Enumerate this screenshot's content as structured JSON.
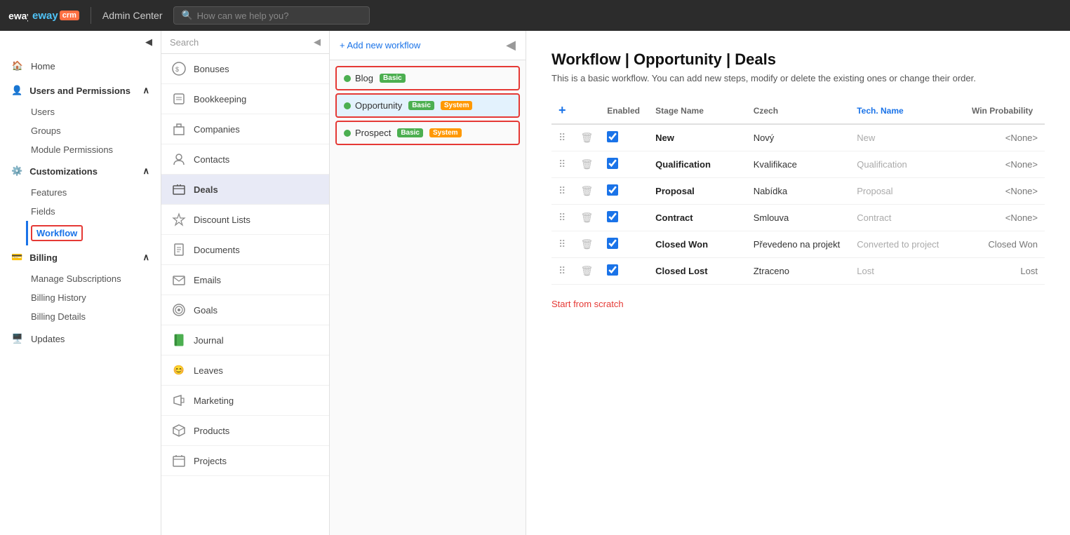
{
  "topbar": {
    "logo_text": "eway",
    "logo_suffix": "crm",
    "title": "Admin Center",
    "search_placeholder": "How can we help you?"
  },
  "sidebar": {
    "collapse_icon": "◀",
    "home_label": "Home",
    "users_section_label": "Users and Permissions",
    "users_items": [
      "Users",
      "Groups",
      "Module Permissions"
    ],
    "customizations_label": "Customizations",
    "customizations_items": [
      "Features",
      "Fields"
    ],
    "workflow_label": "Workflow",
    "billing_label": "Billing",
    "billing_items": [
      "Manage Subscriptions",
      "Billing History",
      "Billing Details"
    ],
    "updates_label": "Updates"
  },
  "module_panel": {
    "search_placeholder": "Search",
    "collapse_icon": "◀",
    "modules": [
      {
        "name": "Bonuses",
        "icon": "💰"
      },
      {
        "name": "Bookkeeping",
        "icon": "📦"
      },
      {
        "name": "Companies",
        "icon": "🏢"
      },
      {
        "name": "Contacts",
        "icon": "👤"
      },
      {
        "name": "Deals",
        "icon": "💼",
        "selected": true
      },
      {
        "name": "Discount Lists",
        "icon": "🏷️"
      },
      {
        "name": "Documents",
        "icon": "📄"
      },
      {
        "name": "Emails",
        "icon": "✉️"
      },
      {
        "name": "Goals",
        "icon": "🎯"
      },
      {
        "name": "Journal",
        "icon": "📓"
      },
      {
        "name": "Leaves",
        "icon": "😊"
      },
      {
        "name": "Marketing",
        "icon": "📢"
      },
      {
        "name": "Products",
        "icon": "📦"
      },
      {
        "name": "Projects",
        "icon": "📋"
      }
    ]
  },
  "workflow_list": {
    "add_label": "+ Add new workflow",
    "entries": [
      {
        "name": "Blog",
        "badges": [
          "Basic"
        ],
        "active": true,
        "selected": false
      },
      {
        "name": "Opportunity",
        "badges": [
          "Basic",
          "System"
        ],
        "active": true,
        "selected": true
      },
      {
        "name": "Prospect",
        "badges": [
          "Basic",
          "System"
        ],
        "active": true,
        "selected": false
      }
    ]
  },
  "content": {
    "title": "Workflow | Opportunity | Deals",
    "description": "This is a basic workflow. You can add new steps, modify or delete the existing ones or change their order.",
    "table_headers": [
      "",
      "",
      "Enabled",
      "Stage Name",
      "Czech",
      "Tech. Name",
      "Win Probability"
    ],
    "rows": [
      {
        "stage": "New",
        "czech": "Nový",
        "tech": "New",
        "win": "<None>",
        "enabled": true
      },
      {
        "stage": "Qualification",
        "czech": "Kvalifikace",
        "tech": "Qualification",
        "win": "<None>",
        "enabled": true
      },
      {
        "stage": "Proposal",
        "czech": "Nabídka",
        "tech": "Proposal",
        "win": "<None>",
        "enabled": true
      },
      {
        "stage": "Contract",
        "czech": "Smlouva",
        "tech": "Contract",
        "win": "<None>",
        "enabled": true
      },
      {
        "stage": "Closed Won",
        "czech": "Převedeno na projekt",
        "tech": "Converted to project",
        "win": "Closed Won",
        "enabled": true
      },
      {
        "stage": "Closed Lost",
        "czech": "Ztraceno",
        "tech": "Lost",
        "win": "Lost",
        "enabled": true
      }
    ],
    "start_scratch_label": "Start from scratch"
  }
}
